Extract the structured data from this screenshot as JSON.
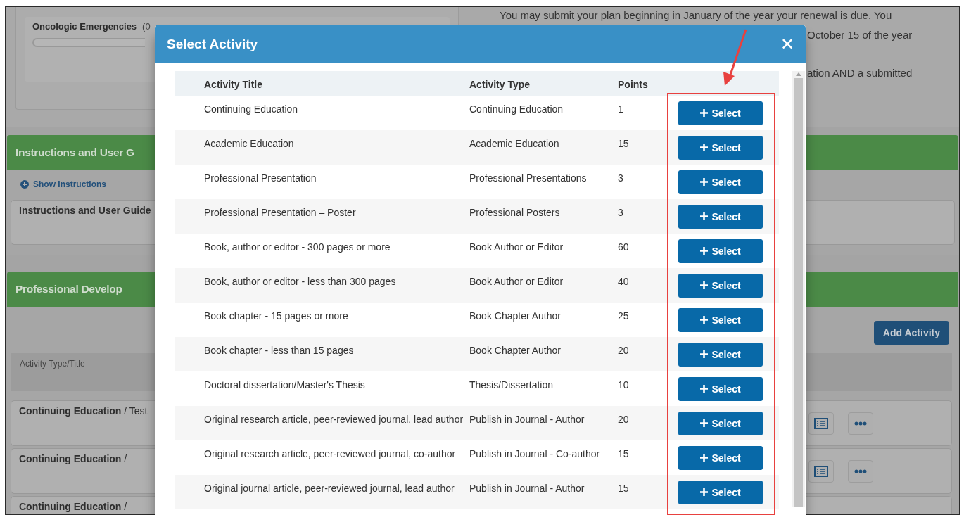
{
  "background": {
    "progress_card": {
      "title": "Oncologic Emergencies",
      "count": "(0",
      "level": 0
    },
    "notice_lines": [
      "You may submit your plan beginning in January of the year your renewal is due. You",
      "October 15 of the year",
      "ation AND a submitted"
    ],
    "instructions_section": {
      "heading": "Instructions and User G",
      "toggle": "Show Instructions",
      "card_title": "Instructions and User Guide"
    },
    "development_section": {
      "heading": "Professional Develop",
      "add_button": "Add Activity",
      "column": "Activity Type/Title",
      "rows": [
        {
          "label": "**Continuing Education** / Test",
          "actions": true
        },
        {
          "label": "**Continuing Education** /",
          "actions": true
        },
        {
          "label": "**Continuing Education** /",
          "actions": false
        }
      ]
    }
  },
  "modal": {
    "title": "Select Activity",
    "close": "✕",
    "columns": [
      "Activity Title",
      "Activity Type",
      "Points"
    ],
    "rows": [
      {
        "title": "Continuing Education",
        "type": "Continuing Education",
        "points": "1",
        "button": "Select"
      },
      {
        "title": "Academic Education",
        "type": "Academic Education",
        "points": "15",
        "button": "Select"
      },
      {
        "title": "Professional Presentation",
        "type": "Professional Presentations",
        "points": "3",
        "button": "Select"
      },
      {
        "title": "Professional Presentation – Poster",
        "type": "Professional Posters",
        "points": "3",
        "button": "Select"
      },
      {
        "title": "Book, author or editor - 300 pages or more",
        "type": "Book Author or Editor",
        "points": "60",
        "button": "Select"
      },
      {
        "title": "Book, author or editor - less than 300 pages",
        "type": "Book Author or Editor",
        "points": "40",
        "button": "Select"
      },
      {
        "title": "Book chapter - 15 pages or more",
        "type": "Book Chapter Author",
        "points": "25",
        "button": "Select"
      },
      {
        "title": "Book chapter - less than 15 pages",
        "type": "Book Chapter Author",
        "points": "20",
        "button": "Select"
      },
      {
        "title": "Doctoral dissertation/Master's Thesis",
        "type": "Thesis/Dissertation",
        "points": "10",
        "button": "Select"
      },
      {
        "title": "Original research article, peer-reviewed journal, lead author",
        "type": "Publish in Journal - Author",
        "points": "20",
        "button": "Select"
      },
      {
        "title": "Original research article, peer-reviewed journal, co-author",
        "type": "Publish in Journal - Co-author",
        "points": "15",
        "button": "Select"
      },
      {
        "title": "Original journal article, peer-reviewed journal, lead author",
        "type": "Publish in Journal - Author",
        "points": "15",
        "button": "Select"
      }
    ]
  }
}
